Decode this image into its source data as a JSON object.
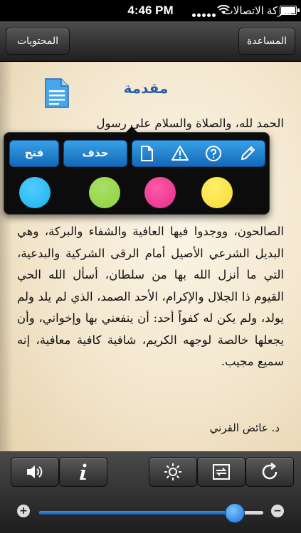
{
  "status_bar": {
    "carrier": "شركة الاتصالات",
    "time": "4:46 PM",
    "battery_level": 1.0
  },
  "nav": {
    "left_button": "المحتويات",
    "right_button": "المساعدة"
  },
  "page": {
    "title": "مقدمة",
    "first_line": "الحمد لله، والصلاة والسلام على رسول",
    "paragraph": "الصالحون، ووجدوا فيها العافية والشفاء والبركة، وهي البديل الشرعي الأصيل أمام الرقى الشركية والبدعية، التي ما أنزل الله بها من سلطان، أسأل الله الحي القيوم ذا الجلال والإكرام، الأحد الصمد، الذي لم يلد ولم يولد، ولم يكن له كفواً أحد: أن ينفعني بها وإخواني، وأن يجعلها خالصة لوجهه الكريم، شافية كافية معافية، إنه سميع مجيب.",
    "signature": "د. عائض القرني"
  },
  "popup": {
    "open_label": "فتح",
    "delete_label": "حذف",
    "icons": [
      "edit-pencil-icon",
      "help-icon",
      "warning-icon",
      "note-page-icon"
    ],
    "colors": [
      "#18b4ef",
      "#8cd13f",
      "#e62d8b",
      "#f6d934"
    ]
  },
  "toolbar": {
    "icons": [
      "speaker-icon",
      "info-icon",
      "brightness-icon",
      "page-swap-icon",
      "refresh-icon"
    ],
    "font_slider_value": 0.87,
    "slider_minus": "−",
    "slider_plus": "+"
  }
}
